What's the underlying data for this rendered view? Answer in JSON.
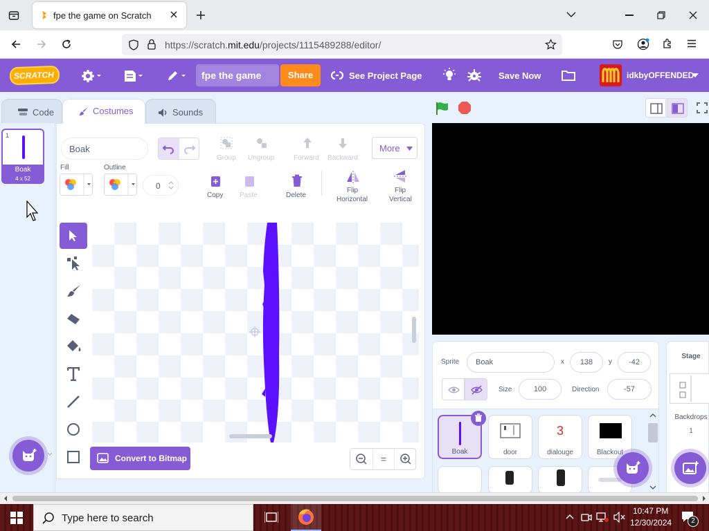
{
  "browser": {
    "tab_title": "fpe the game on Scratch",
    "url_prefix": "https://scratch.",
    "url_domain": "mit.edu",
    "url_path": "/projects/1115489288/editor/"
  },
  "menubar": {
    "logo_text": "SCRATCH",
    "project_title": "fpe the game",
    "share_label": "Share",
    "see_project_label": "See Project Page",
    "save_now_label": "Save Now",
    "username": "idkbyOFFENDED"
  },
  "editor_tabs": {
    "code": "Code",
    "costumes": "Costumes",
    "sounds": "Sounds"
  },
  "costume_list": [
    {
      "index": "1",
      "name": "Boak",
      "size": "4 x 52"
    }
  ],
  "paint": {
    "costume_name": "Boak",
    "fill_label": "Fill",
    "outline_label": "Outline",
    "outline_width": "0",
    "group": "Group",
    "ungroup": "Ungroup",
    "forward": "Forward",
    "backward": "Backward",
    "more": "More",
    "copy": "Copy",
    "paste": "Paste",
    "delete": "Delete",
    "flip_horizontal_1": "Flip",
    "flip_horizontal_2": "Horizontal",
    "flip_vertical_1": "Flip",
    "flip_vertical_2": "Vertical",
    "convert_label": "Convert to Bitmap",
    "zoom_reset": "="
  },
  "sprite_info": {
    "sprite_label": "Sprite",
    "sprite_name": "Boak",
    "x_label": "x",
    "x_value": "138",
    "y_label": "y",
    "y_value": "-42",
    "size_label": "Size",
    "size_value": "100",
    "direction_label": "Direction",
    "direction_value": "-57"
  },
  "sprites": [
    {
      "name": "Boak",
      "selected": true
    },
    {
      "name": "door",
      "selected": false
    },
    {
      "name": "dialouge",
      "selected": false,
      "glyph": "3"
    },
    {
      "name": "Blackout",
      "selected": false
    }
  ],
  "stage_pane": {
    "title": "Stage",
    "backdrops_label": "Backdrops",
    "backdrops_count": "1"
  },
  "taskbar": {
    "search_placeholder": "Type here to search",
    "time": "10:47 PM",
    "date": "12/30/2024",
    "notification_count": "2"
  },
  "colors": {
    "scratch_purple": "#855cd6",
    "share_orange": "#ff8c1a",
    "costume_shape": "#5b10ff",
    "green_flag": "#33b049",
    "stop_red": "#ec5959"
  }
}
